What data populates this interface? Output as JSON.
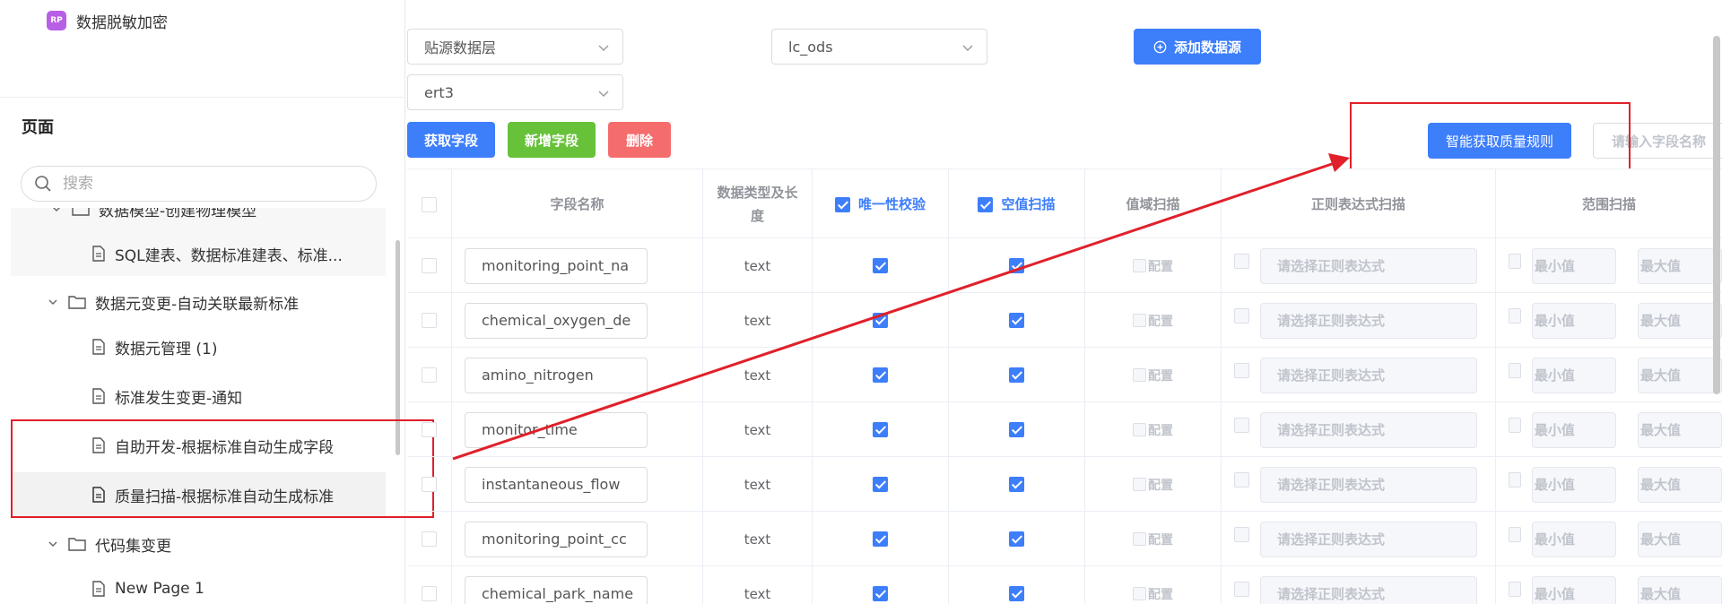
{
  "app": {
    "logo_text": "RP",
    "name": "数据脱敏加密"
  },
  "sidebar": {
    "title": "页面",
    "search_placeholder": "搜索",
    "tree": [
      {
        "label": "数据模型-创建物理模型",
        "type": "folder",
        "expanded": true
      },
      {
        "label": "SQL建表、数据标准建表、标准...",
        "type": "page"
      },
      {
        "label": "数据元变更-自动关联最新标准",
        "type": "folder",
        "expanded": true
      },
      {
        "label": "数据元管理 (1)",
        "type": "page"
      },
      {
        "label": "标准发生变更-通知",
        "type": "page"
      },
      {
        "label": "自助开发-根据标准自动生成字段",
        "type": "page"
      },
      {
        "label": "质量扫描-根据标准自动生成标准",
        "type": "page",
        "selected": true
      },
      {
        "label": "代码集变更",
        "type": "folder",
        "expanded": true
      },
      {
        "label": "New Page 1",
        "type": "page"
      }
    ]
  },
  "toolbar": {
    "source_layer": "贴源数据层",
    "database": "lc_ods",
    "table": "ert3",
    "add_datasource": "添加数据源",
    "get_fields": "获取字段",
    "add_field": "新增字段",
    "delete": "删除",
    "smart_rules": "智能获取质量规则",
    "field_search_placeholder": "请输入字段名称"
  },
  "table": {
    "headers": {
      "name": "字段名称",
      "type": "数据类型及长度",
      "unique": "唯一性校验",
      "null_scan": "空值扫描",
      "domain": "值域扫描",
      "regex": "正则表达式扫描",
      "range": "范围扫描"
    },
    "config_label": "配置",
    "regex_placeholder": "请选择正则表达式",
    "min_placeholder": "最小值",
    "max_placeholder": "最大值",
    "rows": [
      {
        "name": "monitoring_point_na",
        "type": "text"
      },
      {
        "name": "chemical_oxygen_de",
        "type": "text"
      },
      {
        "name": "amino_nitrogen",
        "type": "text"
      },
      {
        "name": "monitor_time",
        "type": "text"
      },
      {
        "name": "instantaneous_flow",
        "type": "text"
      },
      {
        "name": "monitoring_point_cc",
        "type": "text"
      },
      {
        "name": "chemical_park_name",
        "type": "text"
      }
    ]
  },
  "colors": {
    "accent": "#3d7efb",
    "success": "#67c23a",
    "danger": "#f56c6c",
    "highlight": "#e0202a"
  }
}
